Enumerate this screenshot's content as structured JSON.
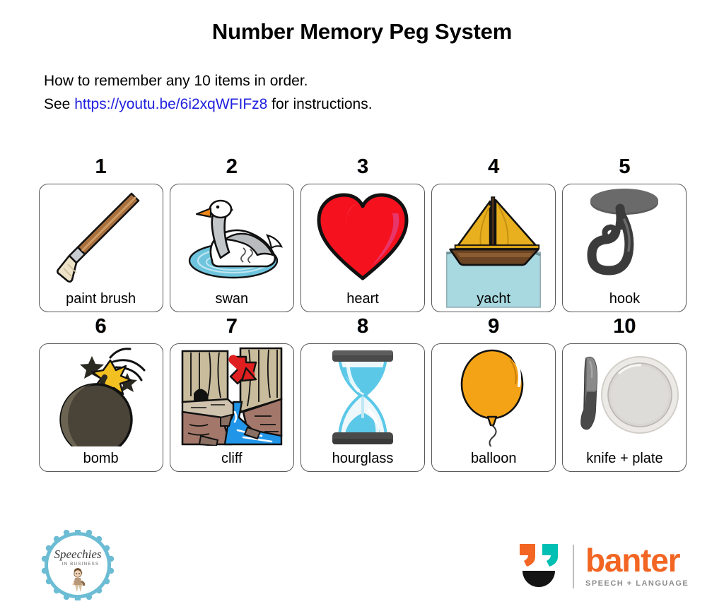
{
  "header": {
    "title": "Number Memory Peg System",
    "intro_line1": "How to remember any 10 items in order.",
    "intro_prefix": "See ",
    "link_text": "https://youtu.be/6i2xqWFIFz8",
    "intro_suffix": " for instructions."
  },
  "cards": [
    {
      "number": "1",
      "label": "paint brush",
      "icon": "paint-brush-icon"
    },
    {
      "number": "2",
      "label": "swan",
      "icon": "swan-icon"
    },
    {
      "number": "3",
      "label": "heart",
      "icon": "heart-icon"
    },
    {
      "number": "4",
      "label": "yacht",
      "icon": "yacht-icon"
    },
    {
      "number": "5",
      "label": "hook",
      "icon": "hook-icon"
    },
    {
      "number": "6",
      "label": "bomb",
      "icon": "bomb-icon"
    },
    {
      "number": "7",
      "label": "cliff",
      "icon": "cliff-icon"
    },
    {
      "number": "8",
      "label": "hourglass",
      "icon": "hourglass-icon"
    },
    {
      "number": "9",
      "label": "balloon",
      "icon": "balloon-icon"
    },
    {
      "number": "10",
      "label": "knife + plate",
      "icon": "knife-plate-icon"
    }
  ],
  "footer": {
    "speechies": {
      "name": "Speechies",
      "tagline": "IN BUSINESS"
    },
    "banter": {
      "name": "banter",
      "tagline": "SPEECH + LANGUAGE"
    }
  },
  "colors": {
    "link": "#2020e0",
    "banter_orange": "#f26522",
    "banter_teal": "#00bfb3",
    "banter_gray": "#8d8d8d",
    "speechies_blue": "#6cbcd4",
    "card_border": "#595959",
    "heart_red": "#f5121e",
    "yacht_sail": "#e8b01e",
    "yacht_hull": "#6b4423",
    "water_blue": "#a8d8e0",
    "cliff_wall": "#c9bc9c",
    "cliff_rock": "#a3786a",
    "river_blue": "#2196e8",
    "arrow_red": "#e02020",
    "bomb_body": "#4a4438",
    "spark_yellow": "#f2c021",
    "sand_cyan": "#5bc8e8",
    "cap_gray": "#4a4a4a",
    "balloon_orange": "#f5a316",
    "hook_gray": "#3b3b3b",
    "plate_gray": "#d8d6d2",
    "knife_gray": "#5a5a5a"
  }
}
